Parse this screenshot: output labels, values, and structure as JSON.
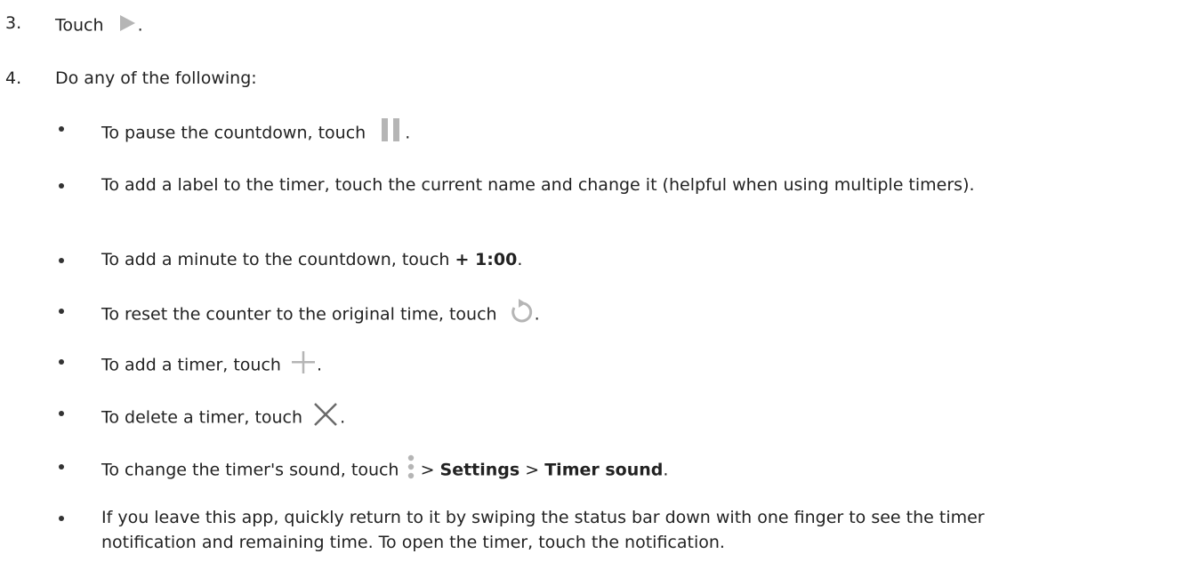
{
  "steps": [
    {
      "number": "3.",
      "text_before": "Touch",
      "icon": "play-icon",
      "text_after": "."
    },
    {
      "number": "4.",
      "text": "Do any of the following:"
    }
  ],
  "bullets": {
    "pause": {
      "before": "To pause the countdown, touch",
      "icon": "pause-icon",
      "after": "."
    },
    "label": {
      "text": "To add a label to the timer, touch the current name and change it (helpful when using multiple timers)."
    },
    "minute": {
      "before": "To add a minute to the countdown, touch ",
      "bold": "+ 1:00",
      "after": "."
    },
    "reset": {
      "before": "To reset the counter to the original time, touch",
      "icon": "reset-icon",
      "after": "."
    },
    "add": {
      "before": "To add a timer, touch",
      "icon": "plus-icon",
      "after": "."
    },
    "delete": {
      "before": "To delete a timer, touch",
      "icon": "close-icon",
      "after": "."
    },
    "sound": {
      "before": "To change the timer's sound, touch",
      "icon": "more-vert-icon",
      "sep1": " > ",
      "bold1": "Settings",
      "sep2": " > ",
      "bold2": "Timer sound",
      "after": "."
    },
    "leave": {
      "text": "If you leave this app, quickly return to it by swiping the status bar down with one finger to see the timer notification and remaining time. To open the timer, touch the notification."
    }
  },
  "colors": {
    "text": "#222222",
    "icon_gray": "#b5b5b5"
  }
}
